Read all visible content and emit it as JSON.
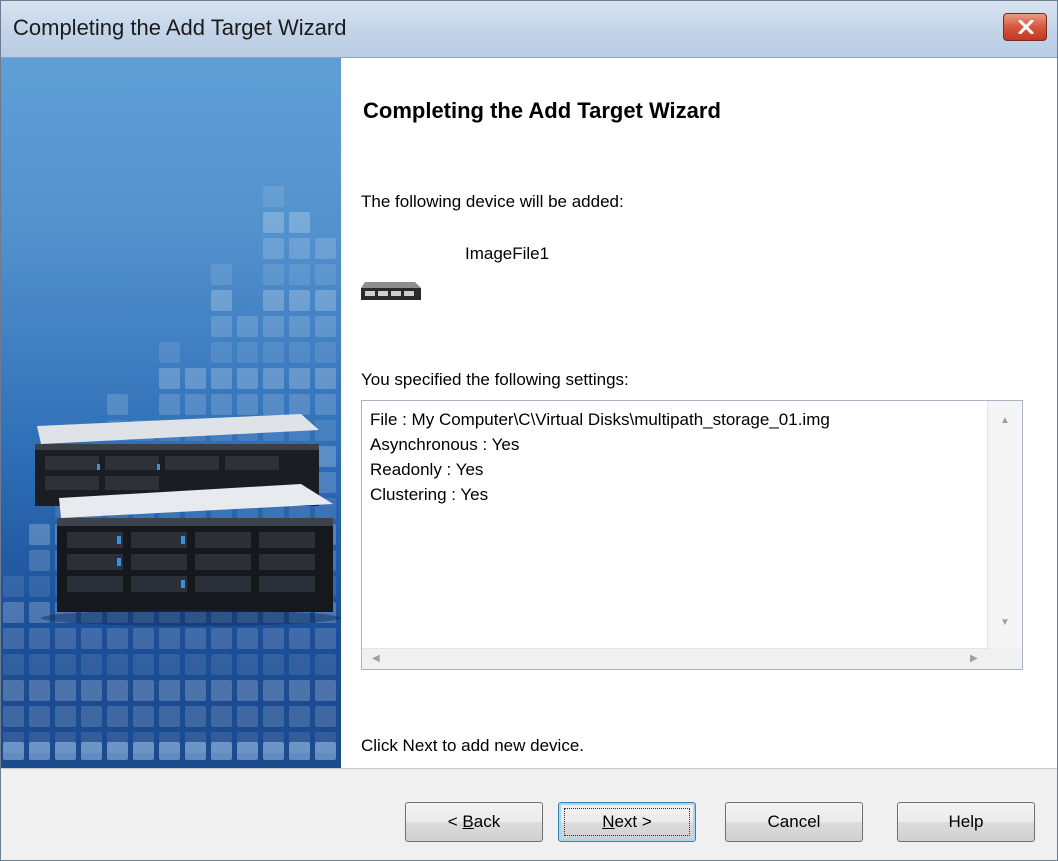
{
  "window": {
    "title": "Completing the Add Target Wizard"
  },
  "content": {
    "heading": "Completing the Add Target Wizard",
    "device_intro": "The following device will be added:",
    "device_name": "ImageFile1",
    "device_icon": "storage-device-icon",
    "settings_intro": "You specified the following settings:",
    "settings": [
      "File : My Computer\\C\\Virtual Disks\\multipath_storage_01.img",
      "Asynchronous : Yes",
      "Readonly : Yes",
      "Clustering : Yes"
    ],
    "instruction": "Click Next to add new device."
  },
  "buttons": {
    "back": {
      "prefix": "< ",
      "mnemonic": "B",
      "rest": "ack"
    },
    "next": {
      "mnemonic": "N",
      "rest": "ext >"
    },
    "cancel": "Cancel",
    "help": "Help"
  },
  "colors": {
    "side_panel_top": "#5f9fd6",
    "side_panel_bottom": "#1b4a8d",
    "close_button": "#d4593f"
  }
}
